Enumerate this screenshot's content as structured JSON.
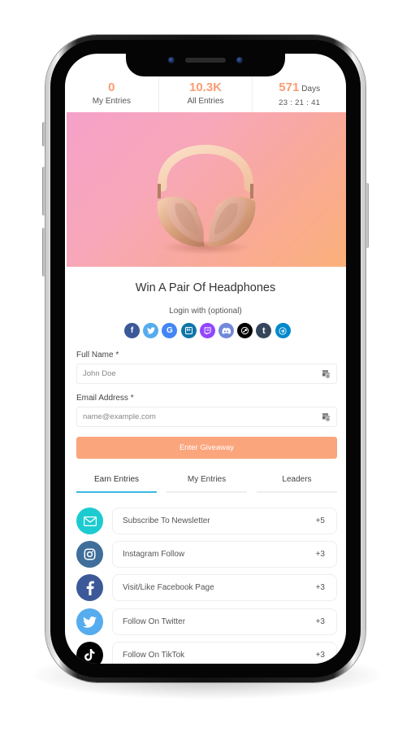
{
  "stats": {
    "my_entries": {
      "value": "0",
      "label": "My Entries"
    },
    "all_entries": {
      "value": "10.3K",
      "label": "All Entries"
    },
    "countdown": {
      "value": "571",
      "unit": "Days",
      "timer": "23 : 21 : 41"
    }
  },
  "hero": {
    "alt": "Pair of pink/gold over-ear headphones on pink-orange gradient background"
  },
  "giveaway": {
    "title": "Win A Pair Of Headphones",
    "login_label": "Login with (optional)",
    "login_providers": [
      {
        "name": "facebook",
        "glyph": "f",
        "color": "#3b5998"
      },
      {
        "name": "twitter",
        "glyph": "t",
        "color": "#55acee"
      },
      {
        "name": "google",
        "glyph": "G",
        "color": "#4285f4"
      },
      {
        "name": "linkedin",
        "glyph": "in",
        "color": "#0e76a8"
      },
      {
        "name": "twitch",
        "glyph": "tw",
        "color": "#9146ff"
      },
      {
        "name": "discord",
        "glyph": "d",
        "color": "#7289da"
      },
      {
        "name": "steam",
        "glyph": "s",
        "color": "#000000"
      },
      {
        "name": "tumblr",
        "glyph": "t",
        "color": "#35465c"
      },
      {
        "name": "telegram",
        "glyph": "tg",
        "color": "#0088cc"
      }
    ]
  },
  "form": {
    "full_name": {
      "label": "Full Name *",
      "placeholder": "John Doe",
      "value": ""
    },
    "email": {
      "label": "Email Address *",
      "placeholder": "name@example.com",
      "value": ""
    },
    "submit_label": "Enter Giveaway"
  },
  "tabs": [
    {
      "label": "Earn Entries",
      "active": true
    },
    {
      "label": "My Entries",
      "active": false
    },
    {
      "label": "Leaders",
      "active": false
    }
  ],
  "entries": [
    {
      "label": "Subscribe To Newsletter",
      "points": "+5",
      "icon": "mail-icon",
      "color": "#1ccbd0"
    },
    {
      "label": "Instagram Follow",
      "points": "+3",
      "icon": "instagram-icon",
      "color": "#3f6e9a"
    },
    {
      "label": "Visit/Like Facebook Page",
      "points": "+3",
      "icon": "facebook-icon",
      "color": "#3b5998"
    },
    {
      "label": "Follow On Twitter",
      "points": "+3",
      "icon": "twitter-icon",
      "color": "#55acee"
    },
    {
      "label": "Follow On TikTok",
      "points": "+3",
      "icon": "tiktok-icon",
      "color": "#000000"
    }
  ],
  "colors": {
    "accent": "#f99d73",
    "button": "#fba57d",
    "tab_active": "#3bb8e2"
  }
}
